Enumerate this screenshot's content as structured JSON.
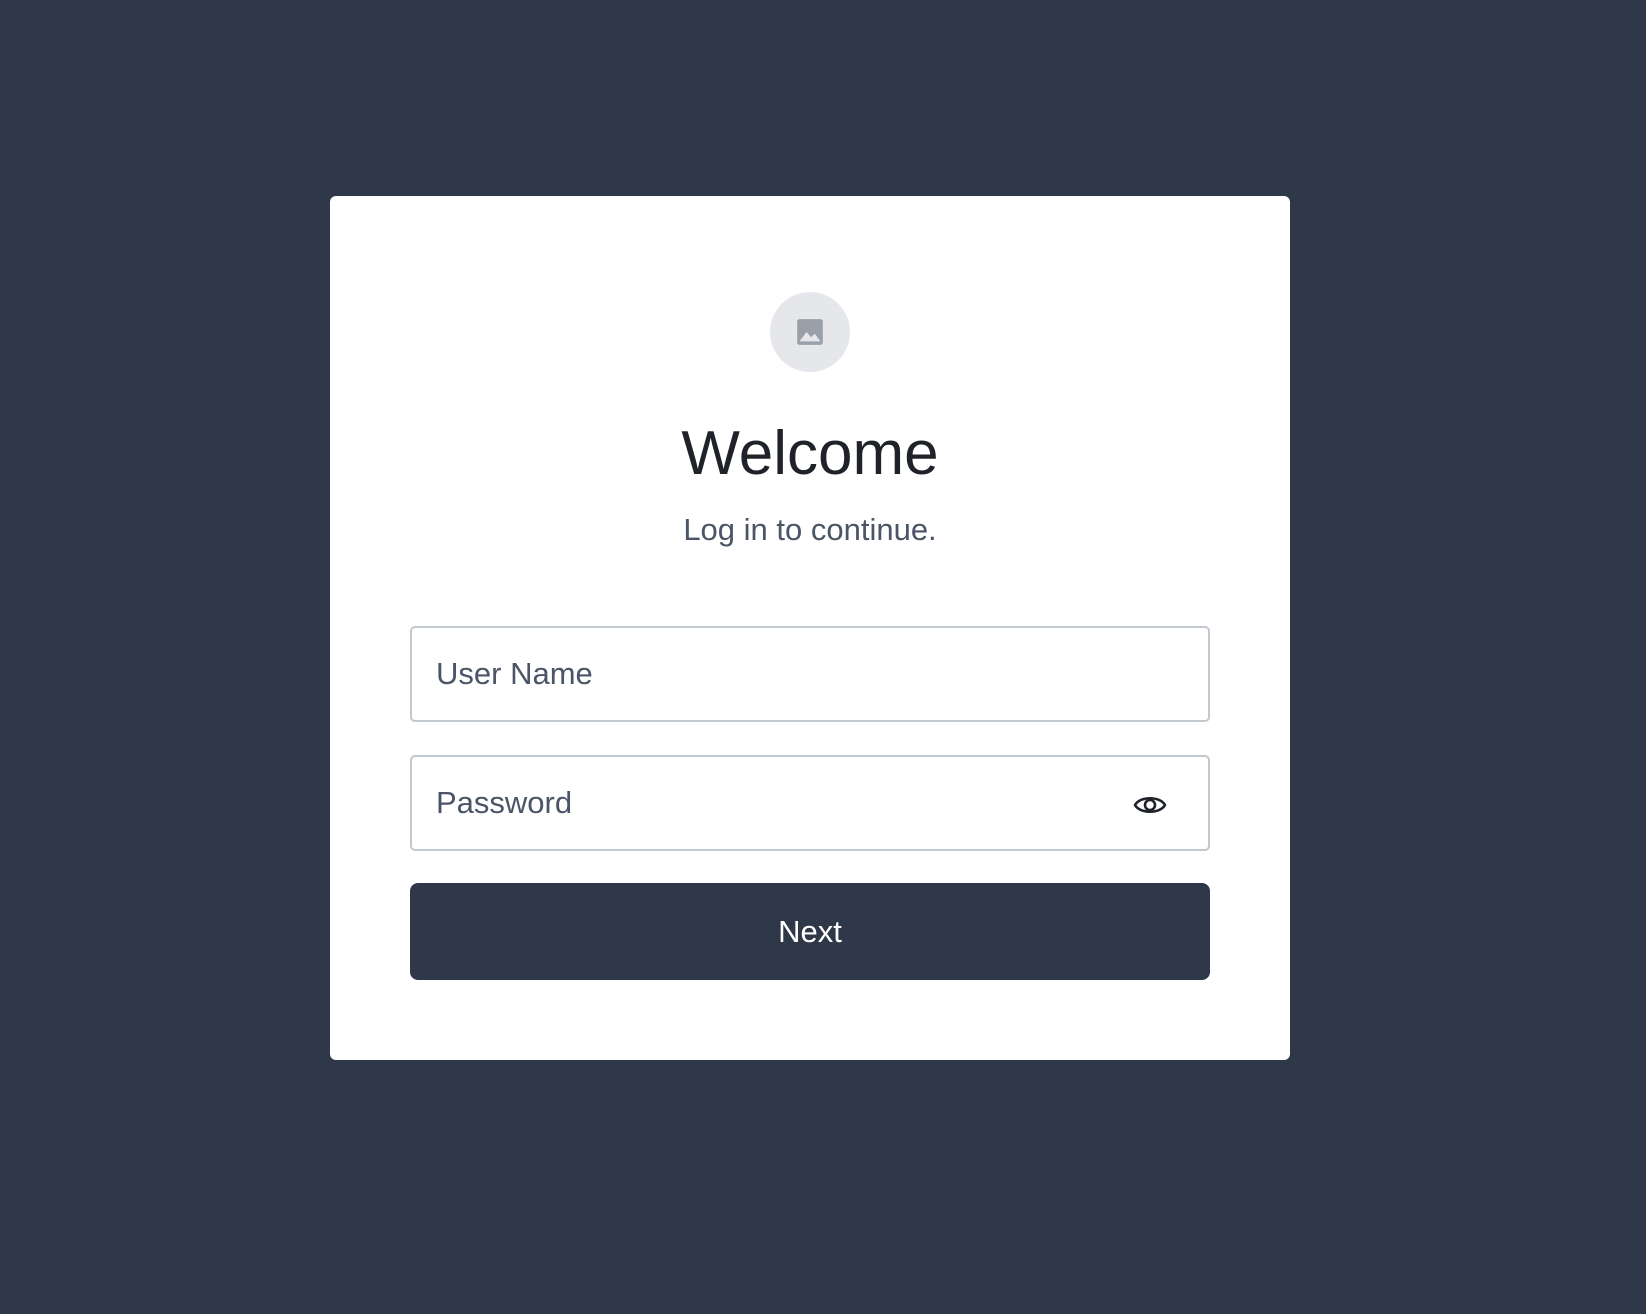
{
  "login": {
    "logo_icon": "image-placeholder-icon",
    "title": "Welcome",
    "subtitle": "Log in to continue.",
    "username": {
      "placeholder": "User Name",
      "value": ""
    },
    "password": {
      "placeholder": "Password",
      "value": "",
      "toggle_icon": "eye-icon"
    },
    "next_label": "Next"
  },
  "colors": {
    "background": "#2e3849",
    "card": "#ffffff",
    "button": "#2e3849",
    "input_border": "#c2c8cf",
    "logo_circle": "#e5e7eb"
  }
}
